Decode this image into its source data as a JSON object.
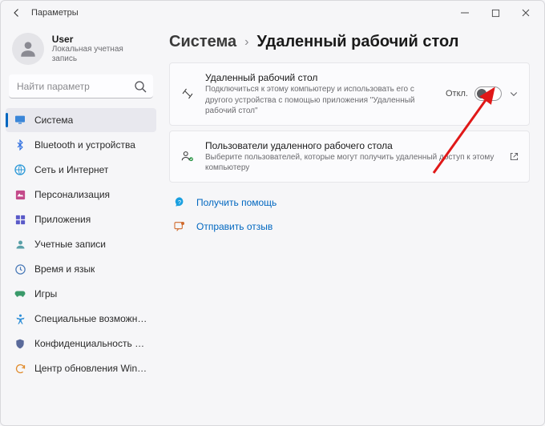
{
  "window": {
    "title": "Параметры"
  },
  "account": {
    "name": "User",
    "subtitle": "Локальная учетная запись"
  },
  "search": {
    "placeholder": "Найти параметр"
  },
  "nav": [
    {
      "id": "system",
      "label": "Система",
      "icon": "system",
      "selected": true
    },
    {
      "id": "bt",
      "label": "Bluetooth и устройства",
      "icon": "bt"
    },
    {
      "id": "net",
      "label": "Сеть и Интернет",
      "icon": "net"
    },
    {
      "id": "pers",
      "label": "Персонализация",
      "icon": "pers"
    },
    {
      "id": "apps",
      "label": "Приложения",
      "icon": "apps"
    },
    {
      "id": "accts",
      "label": "Учетные записи",
      "icon": "accts"
    },
    {
      "id": "time",
      "label": "Время и язык",
      "icon": "time"
    },
    {
      "id": "games",
      "label": "Игры",
      "icon": "games"
    },
    {
      "id": "access",
      "label": "Специальные возможности",
      "icon": "access"
    },
    {
      "id": "priv",
      "label": "Конфиденциальность и безопасность",
      "icon": "priv"
    },
    {
      "id": "update",
      "label": "Центр обновления Windows",
      "icon": "update"
    }
  ],
  "breadcrumb": {
    "root": "Система",
    "sep": "›",
    "page": "Удаленный рабочий стол"
  },
  "cards": {
    "rdp": {
      "title": "Удаленный рабочий стол",
      "sub": "Подключиться к этому компьютеру и использовать его с другого устройства с помощью приложения \"Удаленный рабочий стол\"",
      "state": "Откл."
    },
    "users": {
      "title": "Пользователи удаленного рабочего стола",
      "sub": "Выберите пользователей, которые могут получить удаленный доступ к этому компьютеру"
    }
  },
  "links": {
    "help": "Получить помощь",
    "feedback": "Отправить отзыв"
  }
}
